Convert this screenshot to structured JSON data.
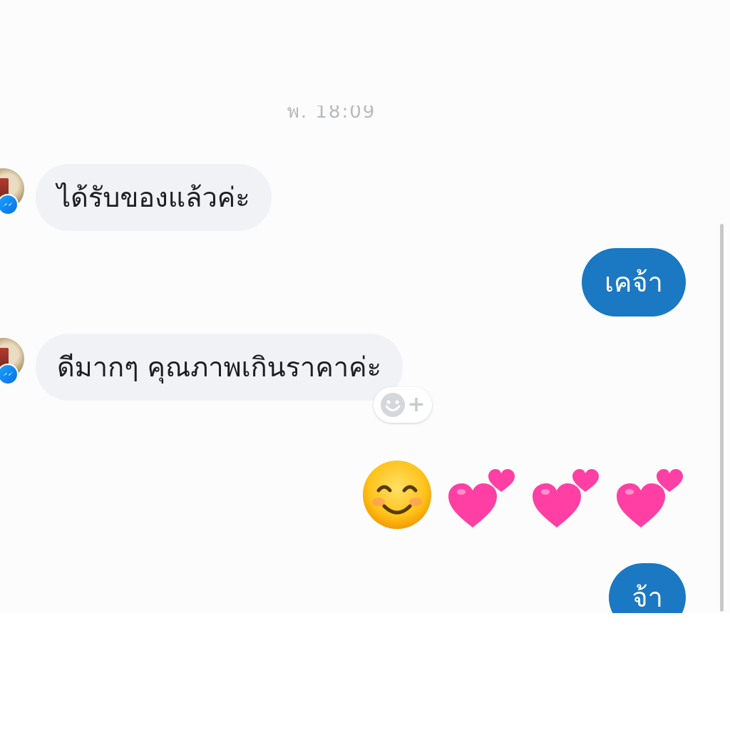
{
  "chat": {
    "timestamp": "พ. 18:09",
    "messages": [
      {
        "direction": "incoming",
        "text": "ได้รับของแล้วค่ะ"
      },
      {
        "direction": "outgoing",
        "text": "เคจ้า"
      },
      {
        "direction": "incoming",
        "text": "ดีมากๆ คุณภาพเกินราคาค่ะ"
      },
      {
        "direction": "outgoing",
        "emojis": [
          "smiling-face-with-smiling-eyes",
          "two-hearts",
          "two-hearts",
          "two-hearts"
        ]
      },
      {
        "direction": "outgoing",
        "text": "จ้า"
      }
    ]
  },
  "colors": {
    "outgoing_bubble": "#1b78c2",
    "incoming_bubble": "#f1f2f6",
    "heart": "#ff3fa4",
    "messenger_badge": "#0a6fe8"
  }
}
